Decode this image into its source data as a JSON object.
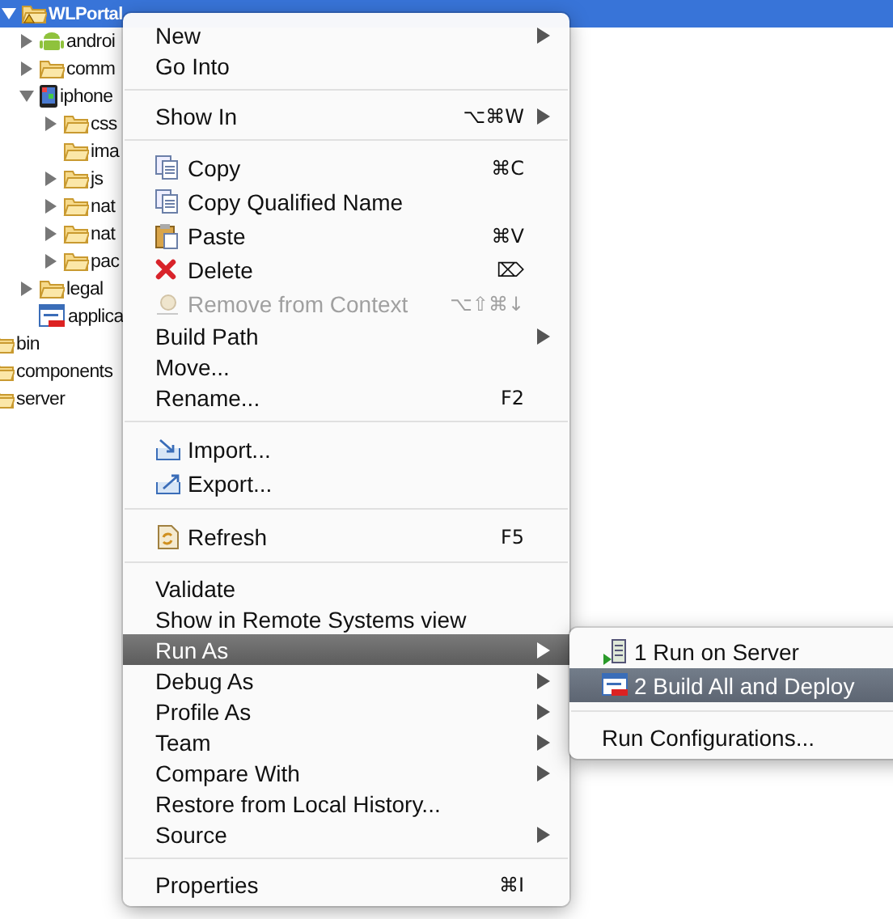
{
  "tree": [
    {
      "label": "WLPortal",
      "kind": "project",
      "expanded": true,
      "selected": true,
      "children": [
        {
          "label": "androi",
          "kind": "android",
          "expanded": false,
          "selected": false
        },
        {
          "label": "comm",
          "kind": "folder",
          "expanded": false,
          "selected": false
        },
        {
          "label": "iphone",
          "kind": "phone",
          "expanded": true,
          "selected": false,
          "children": [
            {
              "label": "css",
              "kind": "folder",
              "expanded": false,
              "selected": false
            },
            {
              "label": "ima",
              "kind": "folder",
              "selected": false
            },
            {
              "label": "js",
              "kind": "folder",
              "expanded": false,
              "selected": false
            },
            {
              "label": "nat",
              "kind": "folder",
              "expanded": false,
              "selected": false
            },
            {
              "label": "nat",
              "kind": "folder",
              "expanded": false,
              "selected": false
            },
            {
              "label": "pac",
              "kind": "folder",
              "expanded": false,
              "selected": false
            }
          ]
        },
        {
          "label": "legal",
          "kind": "folder",
          "expanded": false,
          "selected": false
        },
        {
          "label": "applica",
          "kind": "app",
          "selected": false
        }
      ]
    }
  ],
  "outer_rows": [
    {
      "label": "bin",
      "kind": "folder"
    },
    {
      "label": "components",
      "kind": "folder"
    },
    {
      "label": "server",
      "kind": "folder"
    }
  ],
  "context_menu": {
    "groups": [
      [
        {
          "label": "New",
          "submenu": true,
          "selected": false,
          "disabled": false
        },
        {
          "label": "Go Into",
          "submenu": false,
          "selected": false,
          "disabled": false
        }
      ],
      [
        {
          "label": "Show In",
          "shortcut": "⌥⌘W",
          "submenu": true,
          "selected": false,
          "disabled": false
        }
      ],
      [
        {
          "label": "Copy",
          "kind": "copy",
          "shortcut": "⌘C",
          "submenu": false,
          "selected": false,
          "disabled": false
        },
        {
          "label": "Copy Qualified Name",
          "kind": "copy-name",
          "submenu": false,
          "selected": false,
          "disabled": false
        },
        {
          "label": "Paste",
          "kind": "paste",
          "shortcut": "⌘V",
          "submenu": false,
          "selected": false,
          "disabled": false
        },
        {
          "label": "Delete",
          "kind": "delete",
          "shortcut": "⌦",
          "submenu": false,
          "selected": false,
          "disabled": false
        },
        {
          "label": "Remove from Context",
          "kind": "remove",
          "shortcut": "⌥⇧⌘↓",
          "submenu": false,
          "selected": false,
          "disabled": true
        },
        {
          "label": "Build Path",
          "submenu": true,
          "selected": false,
          "disabled": false
        },
        {
          "label": "Move...",
          "submenu": false,
          "selected": false,
          "disabled": false
        },
        {
          "label": "Rename...",
          "shortcut": "F2",
          "submenu": false,
          "selected": false,
          "disabled": false
        }
      ],
      [
        {
          "label": "Import...",
          "kind": "import",
          "submenu": false,
          "selected": false,
          "disabled": false
        },
        {
          "label": "Export...",
          "kind": "export",
          "submenu": false,
          "selected": false,
          "disabled": false
        }
      ],
      [
        {
          "label": "Refresh",
          "kind": "refresh",
          "shortcut": "F5",
          "submenu": false,
          "selected": false,
          "disabled": false
        }
      ],
      [
        {
          "label": "Validate",
          "submenu": false,
          "selected": false,
          "disabled": false
        },
        {
          "label": "Show in Remote Systems view",
          "submenu": false,
          "selected": false,
          "disabled": false
        },
        {
          "label": "Run As",
          "submenu": true,
          "selected": true,
          "disabled": false
        },
        {
          "label": "Debug As",
          "submenu": true,
          "selected": false,
          "disabled": false
        },
        {
          "label": "Profile As",
          "submenu": true,
          "selected": false,
          "disabled": false
        },
        {
          "label": "Team",
          "submenu": true,
          "selected": false,
          "disabled": false
        },
        {
          "label": "Compare With",
          "submenu": true,
          "selected": false,
          "disabled": false
        },
        {
          "label": "Restore from Local History...",
          "submenu": false,
          "selected": false,
          "disabled": false
        },
        {
          "label": "Source",
          "submenu": true,
          "selected": false,
          "disabled": false
        }
      ],
      [
        {
          "label": "Properties",
          "shortcut": "⌘I",
          "submenu": false,
          "selected": false,
          "disabled": false
        }
      ]
    ]
  },
  "submenu": {
    "groups": [
      [
        {
          "label": "1 Run on Server",
          "kind": "server",
          "selected": false
        },
        {
          "label": "2 Build All and Deploy",
          "kind": "app",
          "selected": true
        }
      ],
      [
        {
          "label": "Run Configurations...",
          "selected": false
        }
      ]
    ]
  }
}
